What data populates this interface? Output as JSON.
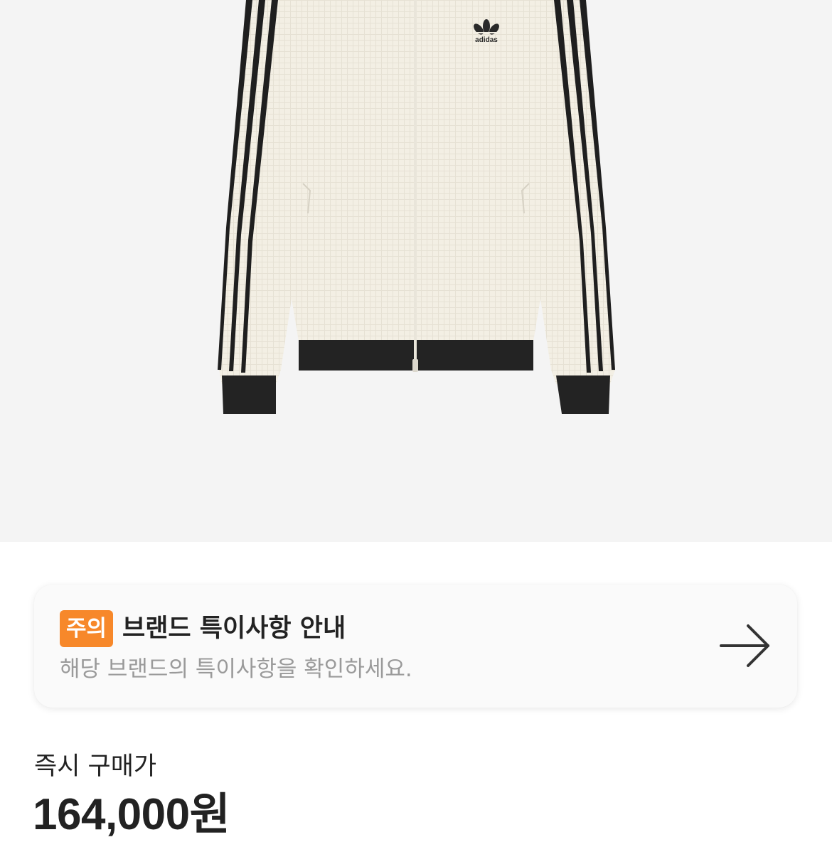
{
  "product": {
    "image_alt": "adidas track jacket",
    "logo_text": "adidas"
  },
  "notice": {
    "badge": "주의",
    "title": "브랜드 특이사항 안내",
    "description": "해당 브랜드의 특이사항을 확인하세요.",
    "badge_color": "#f7882a",
    "arrow_icon": "arrow-right-icon"
  },
  "price": {
    "label": "즉시 구매가",
    "value": "164,000원"
  }
}
